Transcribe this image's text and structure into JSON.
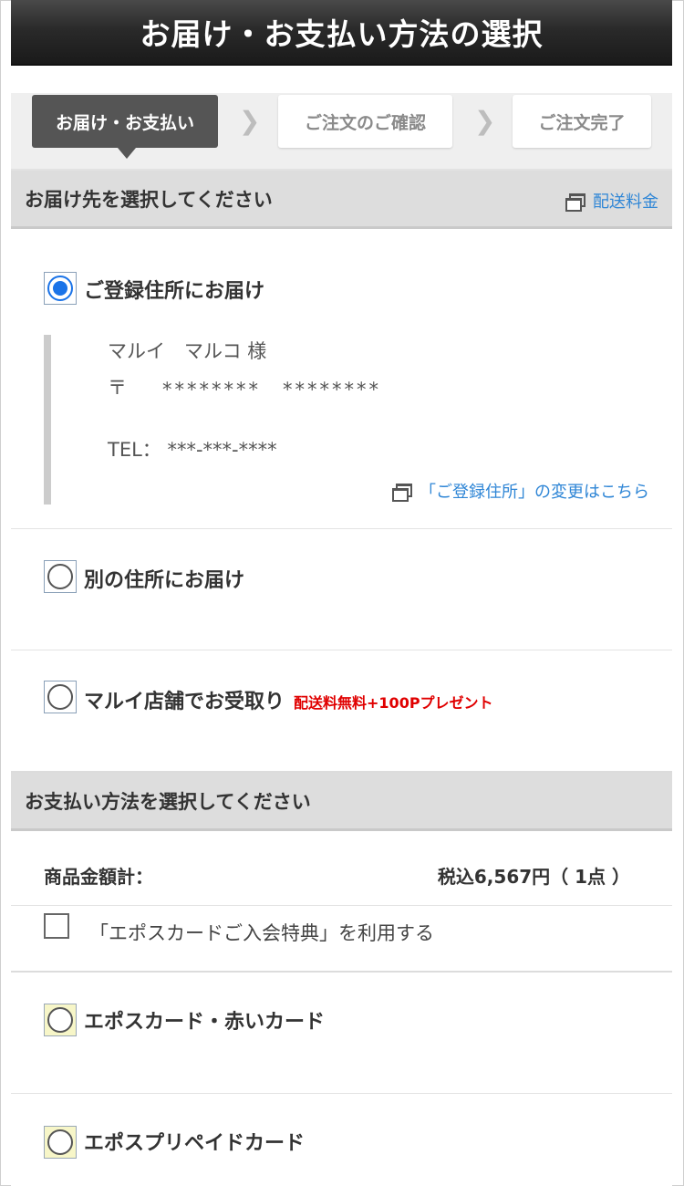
{
  "header": {
    "title": "お届け・お支払い方法の選択"
  },
  "steps": [
    {
      "label": "お届け・お支払い",
      "active": true
    },
    {
      "label": "ご注文のご確認",
      "active": false
    },
    {
      "label": "ご注文完了",
      "active": false
    }
  ],
  "delivery": {
    "section_title": "お届け先を選択してください",
    "shipping_link": "配送料金",
    "options": [
      {
        "label": "ご登録住所にお届け",
        "selected": true
      },
      {
        "label": "別の住所にお届け",
        "selected": false
      },
      {
        "label": "マルイ店舗でお受取り",
        "selected": false,
        "promo": "配送料無料+100Pプレゼント"
      }
    ],
    "address": {
      "name": "マルイ　マルコ 様",
      "postal_mark": "〒",
      "postal_value": "********　********",
      "tel": "TEL：  ***-***-****",
      "change_link": "「ご登録住所」の変更はこちら"
    }
  },
  "payment": {
    "section_title": "お支払い方法を選択してください",
    "total_label": "商品金額計：",
    "total_value": "税込6,567円（ 1点 ）",
    "campaign_checkbox_label": "「エポスカードご入会特典」を利用する",
    "options": [
      {
        "label": "エポスカード・赤いカード",
        "selected": false
      },
      {
        "label": "エポスプリペイドカード",
        "selected": false
      }
    ]
  },
  "colors": {
    "link": "#2f86d6",
    "promo": "#e00000",
    "radio_selected": "#1a73e8",
    "header_bg": "#2a2a2a"
  }
}
